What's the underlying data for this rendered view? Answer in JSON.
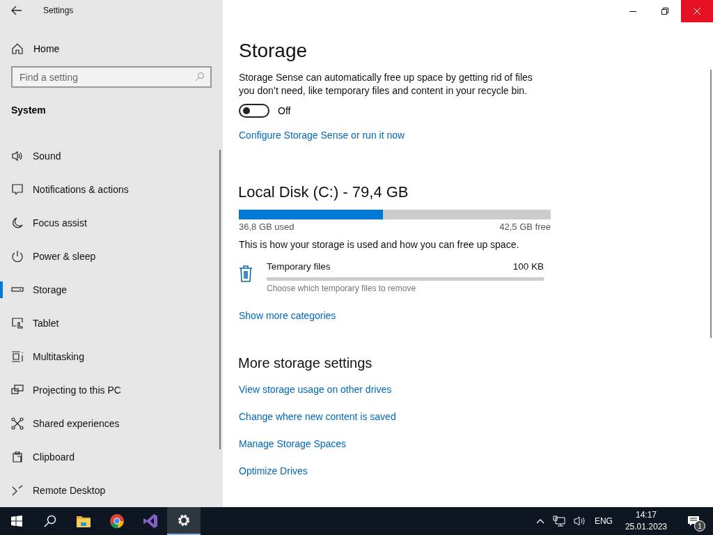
{
  "window": {
    "title": "Settings"
  },
  "sidebar": {
    "home": "Home",
    "search": {
      "placeholder": "Find a setting"
    },
    "section": "System",
    "items": [
      {
        "label": "Sound",
        "selected": false
      },
      {
        "label": "Notifications & actions",
        "selected": false
      },
      {
        "label": "Focus assist",
        "selected": false
      },
      {
        "label": "Power & sleep",
        "selected": false
      },
      {
        "label": "Storage",
        "selected": true
      },
      {
        "label": "Tablet",
        "selected": false
      },
      {
        "label": "Multitasking",
        "selected": false
      },
      {
        "label": "Projecting to this PC",
        "selected": false
      },
      {
        "label": "Shared experiences",
        "selected": false
      },
      {
        "label": "Clipboard",
        "selected": false
      },
      {
        "label": "Remote Desktop",
        "selected": false
      }
    ]
  },
  "page": {
    "title": "Storage",
    "storage_sense": {
      "description": "Storage Sense can automatically free up space by getting rid of files you don’t need, like temporary files and content in your recycle bin.",
      "toggle": {
        "on": false,
        "label": "Off"
      },
      "link": "Configure Storage Sense or run it now"
    },
    "disk": {
      "title": "Local Disk (C:) - 79,4 GB",
      "level": 0.463,
      "used": "36,8 GB used",
      "free": "42,5 GB free",
      "note": "This is how your storage is used and how you can free up space.",
      "categories": [
        {
          "name": "Temporary files",
          "size": "100 KB",
          "level": 0,
          "hint": "Choose which temporary files to remove"
        }
      ],
      "more_link": "Show more categories"
    },
    "more": {
      "title": "More storage settings",
      "links": [
        "View storage usage on other drives",
        "Change where new content is saved",
        "Manage Storage Spaces",
        "Optimize Drives"
      ]
    }
  },
  "taskbar": {
    "apps": [
      {
        "selected": false
      },
      {
        "selected": false
      },
      {
        "selected": false
      },
      {
        "selected": true
      }
    ],
    "tray": {
      "language": "ENG",
      "time": "14:17",
      "date": "25.01.2023",
      "notifications": "1"
    }
  }
}
